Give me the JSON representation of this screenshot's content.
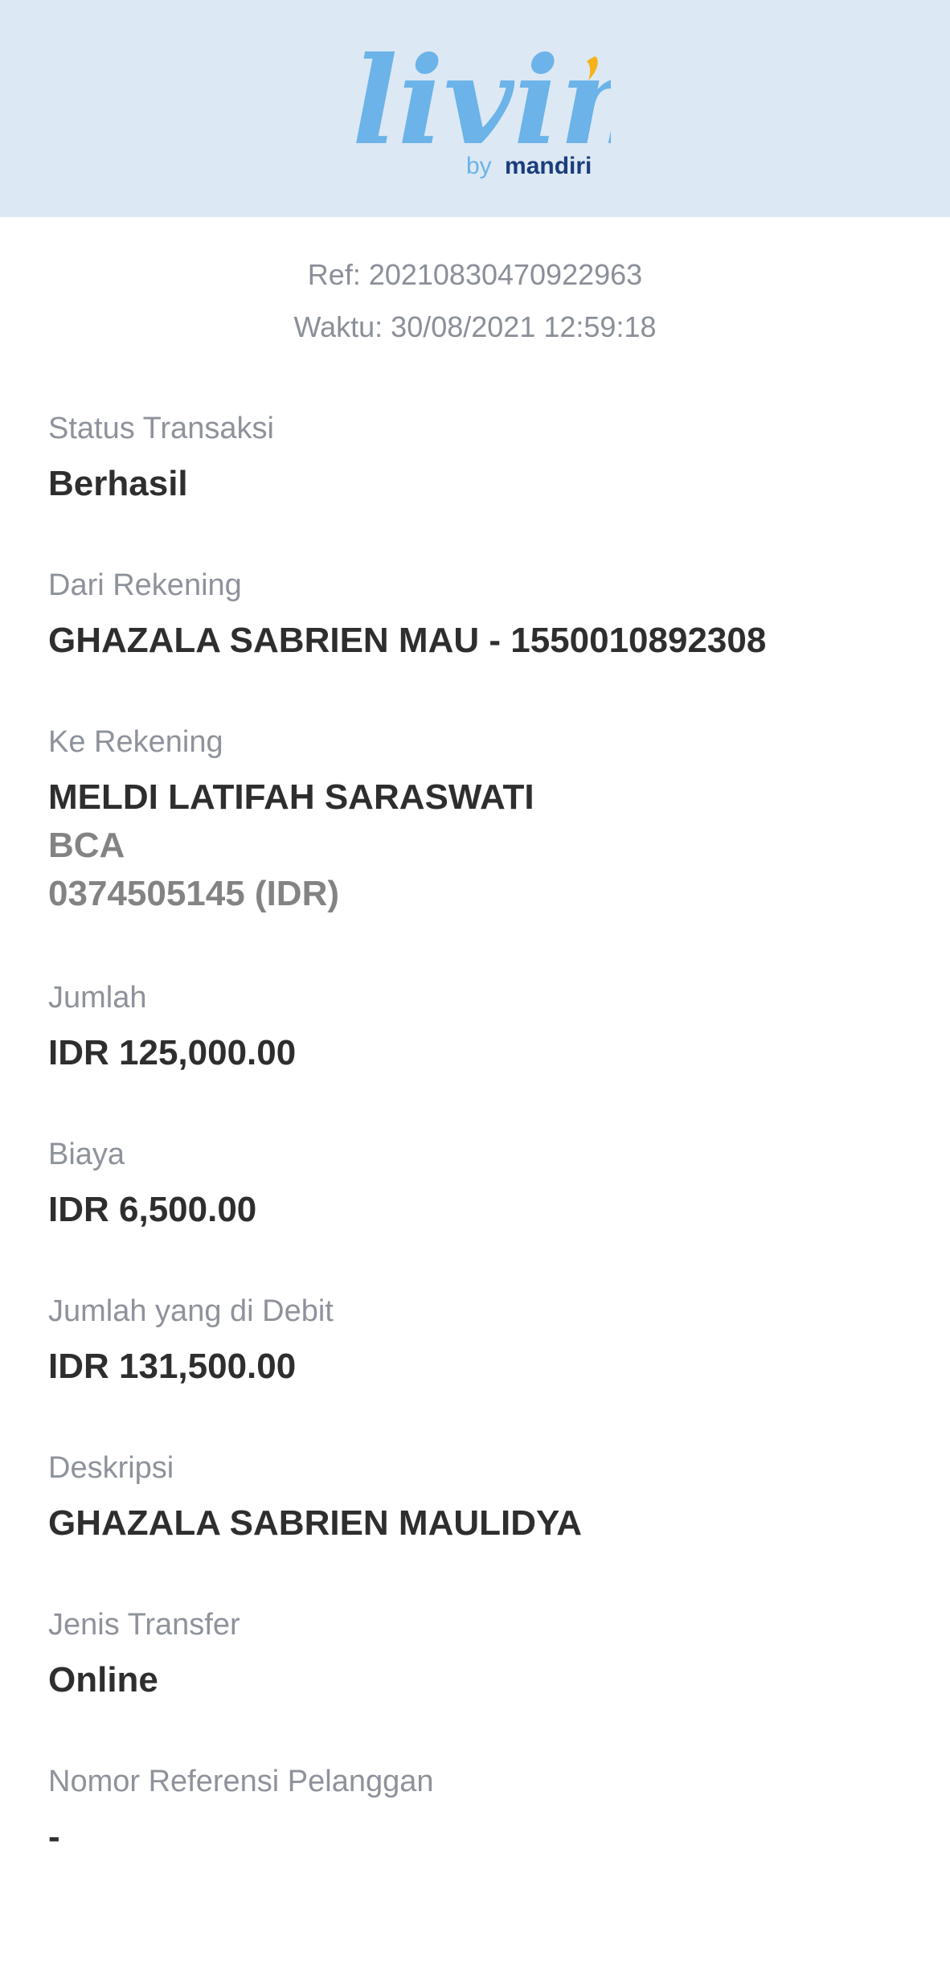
{
  "header": {
    "logo_word": "livin",
    "logo_by": "by",
    "logo_brand": "mandiri",
    "bg_color": "#dce8f4",
    "logo_color": "#6bb3e8",
    "logo_accent_color": "#f5b21a",
    "brand_color": "#1a3d7c"
  },
  "meta": {
    "ref": "Ref: 20210830470922963",
    "time": "Waktu: 30/08/2021 12:59:18"
  },
  "fields": {
    "status": {
      "label": "Status Transaksi",
      "value": "Berhasil"
    },
    "from_account": {
      "label": "Dari Rekening",
      "value": "GHAZALA SABRIEN MAU - 1550010892308"
    },
    "to_account": {
      "label": "Ke Rekening",
      "name": "MELDI LATIFAH SARASWATI",
      "bank": "BCA",
      "number": "0374505145 (IDR)"
    },
    "amount": {
      "label": "Jumlah",
      "value": "IDR 125,000.00"
    },
    "fee": {
      "label": "Biaya",
      "value": "IDR 6,500.00"
    },
    "debited": {
      "label": "Jumlah yang di Debit",
      "value": "IDR 131,500.00"
    },
    "description": {
      "label": "Deskripsi",
      "value": "GHAZALA SABRIEN MAULIDYA"
    },
    "transfer_type": {
      "label": "Jenis Transfer",
      "value": "Online"
    },
    "customer_ref": {
      "label": "Nomor Referensi Pelanggan",
      "value": "-"
    }
  }
}
